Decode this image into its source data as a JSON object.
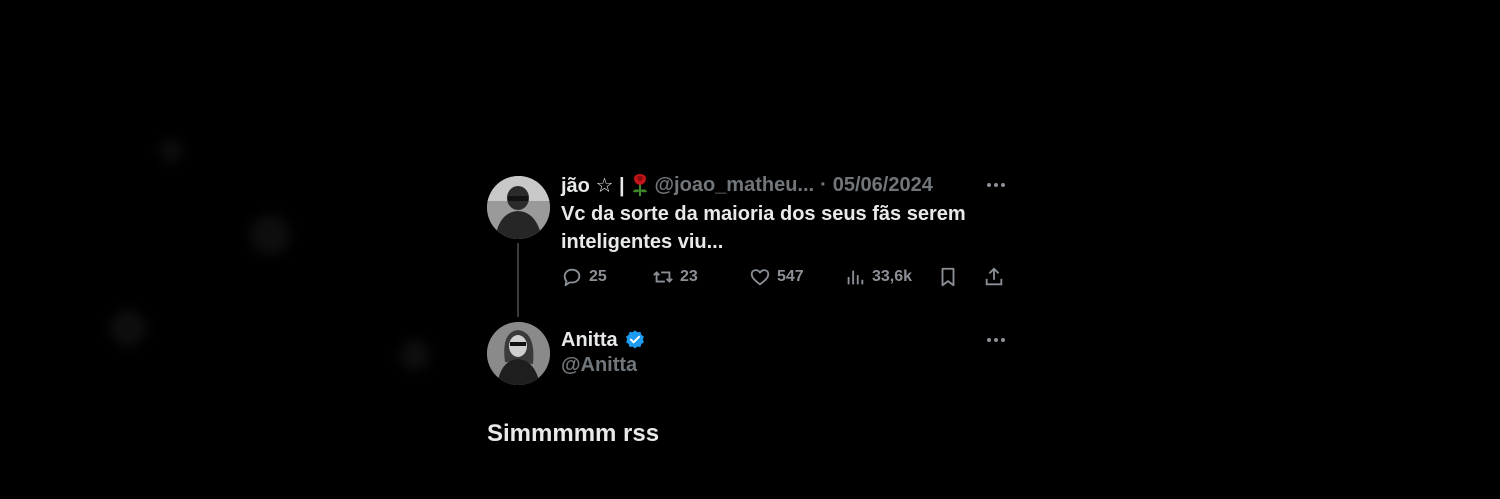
{
  "tweet": {
    "display_name": "jão ☆ |",
    "handle": "@joao_matheu...",
    "separator": "·",
    "date": "05/06/2024",
    "text": "Vc da sorte da maioria dos seus fãs serem inteligentes viu...",
    "actions": {
      "replies": "25",
      "retweets": "23",
      "likes": "547",
      "views": "33,6k"
    }
  },
  "reply": {
    "display_name": "Anitta",
    "handle": "@Anitta",
    "text": "Simmmmm rss",
    "verified_color": "#1d9bf0"
  },
  "colors": {
    "background": "#000000",
    "primary_text": "#e7e9ea",
    "secondary_text": "#71767b"
  }
}
